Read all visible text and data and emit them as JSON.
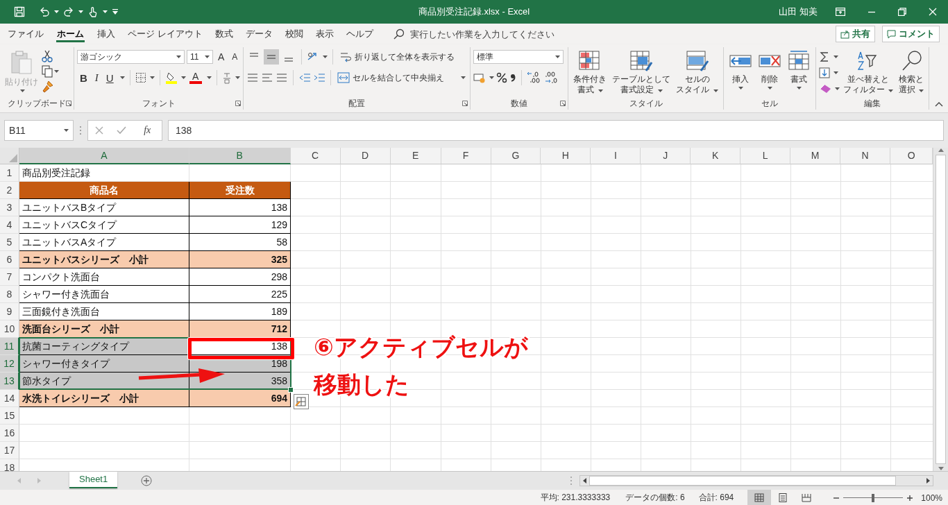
{
  "title_bar": {
    "title": "商品別受注記録.xlsx - Excel",
    "user": "山田 知美"
  },
  "menu_tabs": [
    {
      "label": "ファイル",
      "selected": false
    },
    {
      "label": "ホーム",
      "selected": true
    },
    {
      "label": "挿入",
      "selected": false
    },
    {
      "label": "ページ レイアウト",
      "selected": false
    },
    {
      "label": "数式",
      "selected": false
    },
    {
      "label": "データ",
      "selected": false
    },
    {
      "label": "校閲",
      "selected": false
    },
    {
      "label": "表示",
      "selected": false
    },
    {
      "label": "ヘルプ",
      "selected": false
    }
  ],
  "tell_me": {
    "placeholder": "実行したい作業を入力してください"
  },
  "share_button": "共有",
  "comment_button": "コメント",
  "ribbon": {
    "clipboard": {
      "label": "クリップボード",
      "paste": "貼り付け",
      "paste_disabled": true
    },
    "font": {
      "label": "フォント",
      "name": "游ゴシック",
      "size": "11",
      "grow": "A",
      "shrink": "A",
      "bold": "B",
      "italic": "I",
      "underline": "U",
      "font_color": "A"
    },
    "alignment": {
      "label": "配置",
      "vertical": [
        {
          "kind": "top",
          "selected": false
        },
        {
          "kind": "middle",
          "selected": true
        },
        {
          "kind": "bottom",
          "selected": false
        }
      ],
      "wrap_text": "折り返して全体を表示する",
      "merge": "セルを結合して中央揃え"
    },
    "number": {
      "label": "数値",
      "format": "標準"
    },
    "styles": {
      "label": "スタイル",
      "buttons": [
        {
          "kind": "conditional",
          "lines": [
            "条件付き",
            "書式"
          ]
        },
        {
          "kind": "table",
          "lines": [
            "テーブルとして",
            "書式設定"
          ]
        },
        {
          "kind": "cell_styles",
          "lines": [
            "セルの",
            "スタイル"
          ]
        }
      ]
    },
    "cells": {
      "label": "セル",
      "buttons": [
        {
          "kind": "insert",
          "label": "挿入"
        },
        {
          "kind": "delete",
          "label": "削除"
        },
        {
          "kind": "format",
          "label": "書式"
        }
      ]
    },
    "editing": {
      "label": "編集",
      "buttons": [
        {
          "kind": "sort",
          "lines": [
            "並べ替えと",
            "フィルター"
          ]
        },
        {
          "kind": "find",
          "lines": [
            "検索と",
            "選択"
          ]
        }
      ]
    }
  },
  "formula_bar": {
    "name_box": "B11",
    "function": "fx",
    "formula": "138"
  },
  "sheet": {
    "columns": [
      {
        "label": "A",
        "selected": true
      },
      {
        "label": "B",
        "selected": true
      },
      {
        "label": "C",
        "selected": false
      },
      {
        "label": "D",
        "selected": false
      },
      {
        "label": "E",
        "selected": false
      },
      {
        "label": "F",
        "selected": false
      },
      {
        "label": "G",
        "selected": false
      },
      {
        "label": "H",
        "selected": false
      },
      {
        "label": "I",
        "selected": false
      },
      {
        "label": "J",
        "selected": false
      },
      {
        "label": "K",
        "selected": false
      },
      {
        "label": "L",
        "selected": false
      },
      {
        "label": "M",
        "selected": false
      },
      {
        "label": "N",
        "selected": false
      },
      {
        "label": "O",
        "selected": false
      }
    ],
    "rows": [
      {
        "number": "1",
        "kind": "title",
        "selected": false,
        "cells": [
          "商品別受注記録"
        ]
      },
      {
        "number": "2",
        "kind": "header",
        "selected": false,
        "cells": [
          "商品名",
          "受注数"
        ]
      },
      {
        "number": "3",
        "kind": "item",
        "selected": false,
        "cells": [
          "ユニットバスBタイプ",
          "138"
        ]
      },
      {
        "number": "4",
        "kind": "item",
        "selected": false,
        "cells": [
          "ユニットバスCタイプ",
          "129"
        ]
      },
      {
        "number": "5",
        "kind": "item",
        "selected": false,
        "cells": [
          "ユニットバスAタイプ",
          "58"
        ]
      },
      {
        "number": "6",
        "kind": "subtotal",
        "selected": false,
        "cells": [
          "ユニットバスシリーズ　小計",
          "325"
        ]
      },
      {
        "number": "7",
        "kind": "item",
        "selected": false,
        "cells": [
          "コンパクト洗面台",
          "298"
        ]
      },
      {
        "number": "8",
        "kind": "item",
        "selected": false,
        "cells": [
          "シャワー付き洗面台",
          "225"
        ]
      },
      {
        "number": "9",
        "kind": "item",
        "selected": false,
        "cells": [
          "三面鏡付き洗面台",
          "189"
        ]
      },
      {
        "number": "10",
        "kind": "subtotal",
        "selected": false,
        "cells": [
          "洗面台シリーズ　小計",
          "712"
        ]
      },
      {
        "number": "11",
        "kind": "item",
        "selected": true,
        "active": true,
        "cells": [
          "抗菌コーティングタイプ",
          "138"
        ]
      },
      {
        "number": "12",
        "kind": "item",
        "selected": true,
        "active": false,
        "cells": [
          "シャワー付きタイプ",
          "198"
        ]
      },
      {
        "number": "13",
        "kind": "item",
        "selected": true,
        "active": false,
        "cells": [
          "節水タイプ",
          "358"
        ]
      },
      {
        "number": "14",
        "kind": "subtotal",
        "selected": false,
        "cells": [
          "水洗トイレシリーズ　小計",
          "694"
        ]
      },
      {
        "number": "15",
        "kind": "empty",
        "selected": false
      },
      {
        "number": "16",
        "kind": "empty",
        "selected": false
      },
      {
        "number": "17",
        "kind": "empty",
        "selected": false
      },
      {
        "number": "18",
        "kind": "empty",
        "selected": false
      }
    ]
  },
  "annotation": {
    "lines": [
      "⑥アクティブセルが",
      "移動した"
    ]
  },
  "sheet_tabs": [
    {
      "label": "Sheet1",
      "selected": true
    }
  ],
  "status_bar": {
    "average": "平均: 231.3333333",
    "count": "データの個数: 6",
    "sum": "合計: 694",
    "views": [
      {
        "kind": "normal",
        "selected": true
      },
      {
        "kind": "page_layout",
        "selected": false
      },
      {
        "kind": "page_break",
        "selected": false
      }
    ],
    "zoom": {
      "level": 0.5,
      "reading": "100%"
    }
  }
}
